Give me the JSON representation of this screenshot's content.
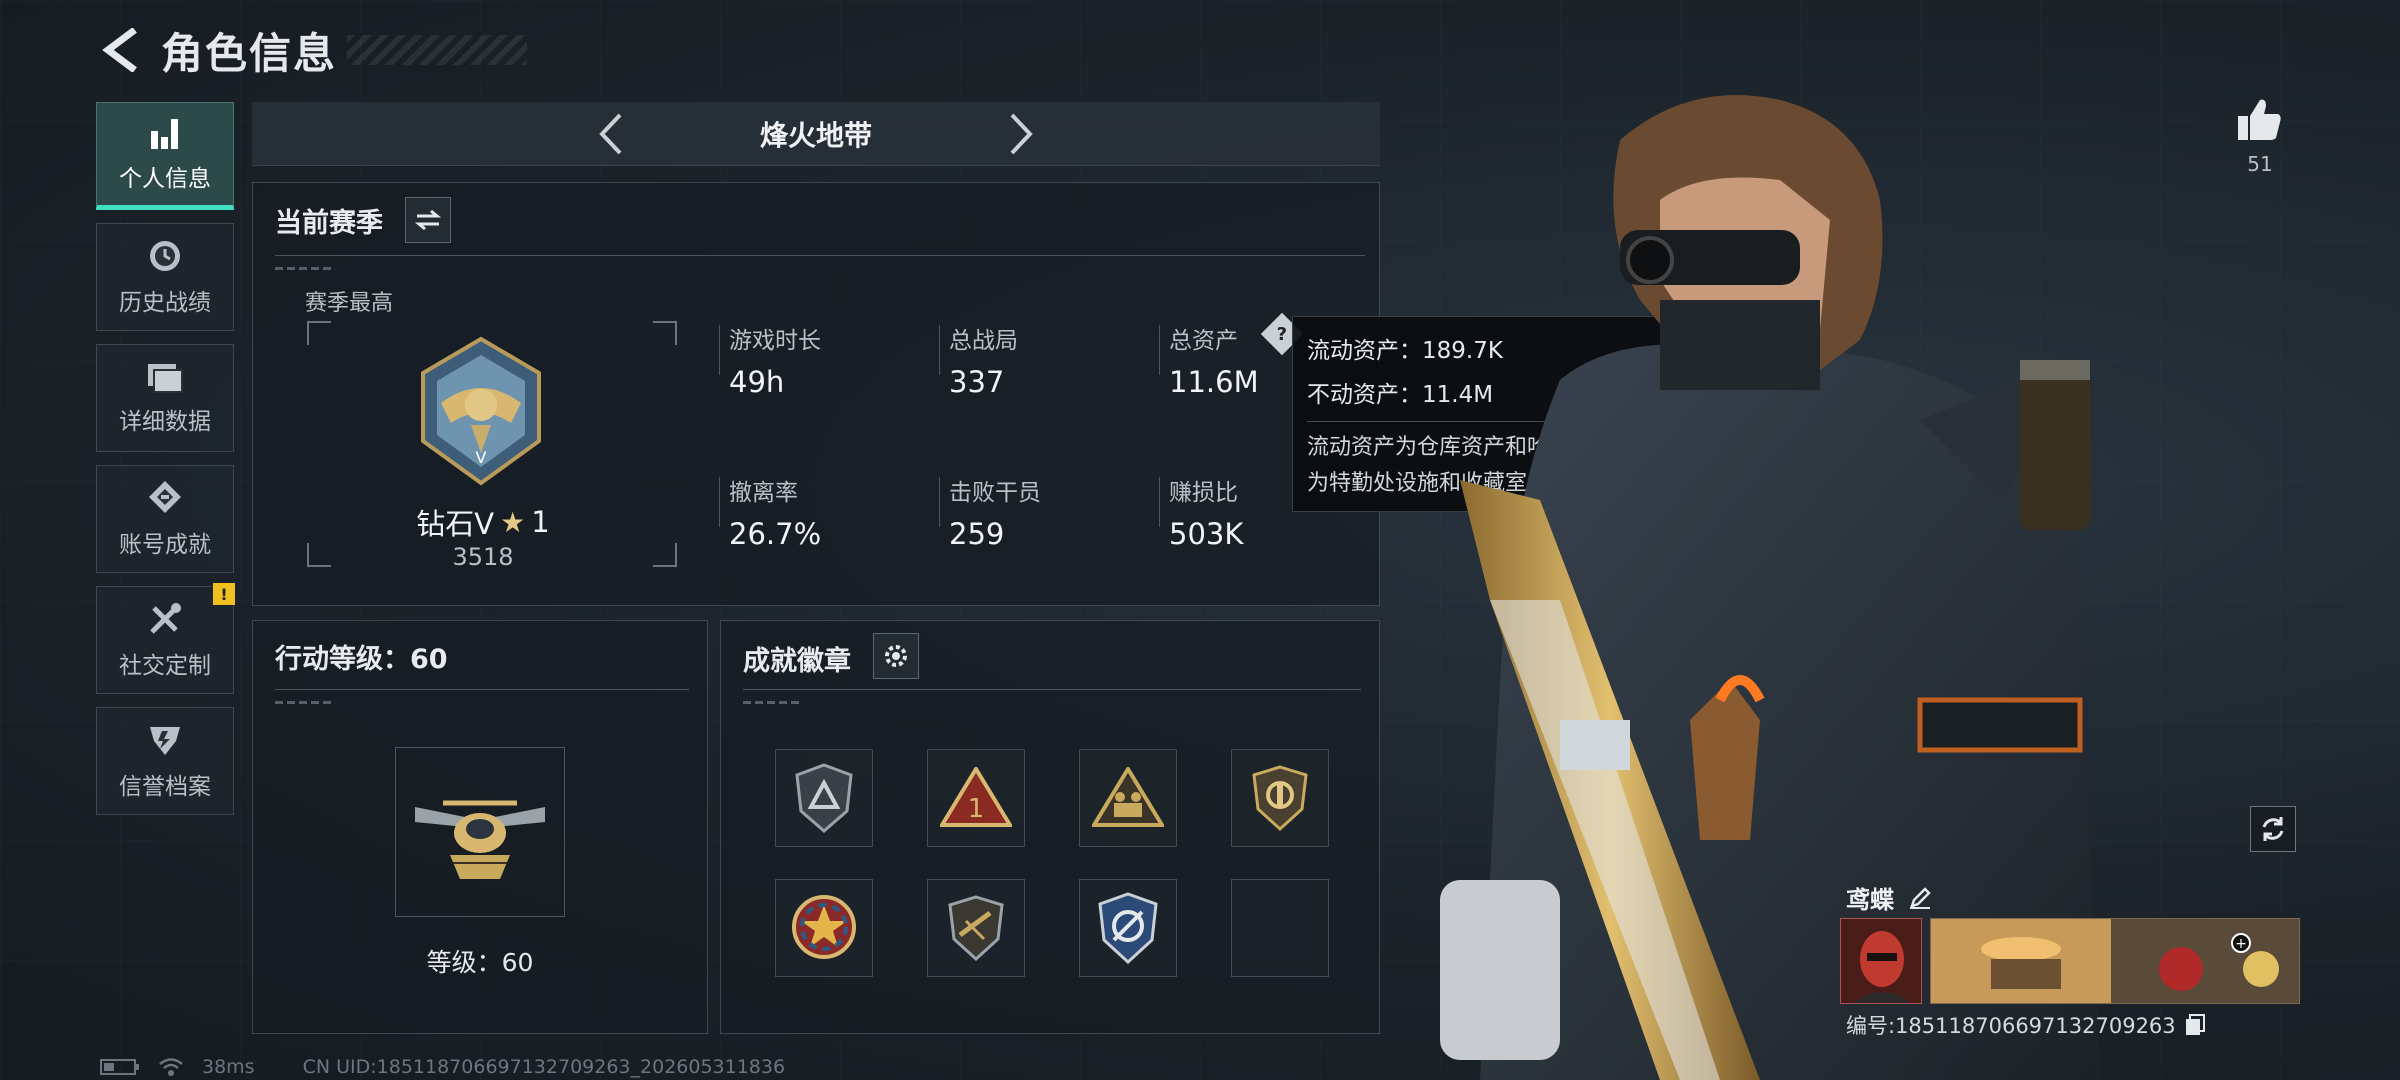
{
  "header": {
    "title": "角色信息",
    "back_icon": "chevron-left-icon"
  },
  "sidebar": {
    "items": [
      {
        "label": "个人信息",
        "icon": "bar-chart-icon",
        "active": true
      },
      {
        "label": "历史战绩",
        "icon": "history-icon"
      },
      {
        "label": "详细数据",
        "icon": "folder-icon"
      },
      {
        "label": "账号成就",
        "icon": "achievement-icon"
      },
      {
        "label": "社交定制",
        "icon": "tools-icon",
        "badge": "!"
      },
      {
        "label": "信誉档案",
        "icon": "credit-icon"
      }
    ]
  },
  "mode": {
    "title": "烽火地带"
  },
  "season": {
    "title": "当前赛季",
    "best_label": "赛季最高",
    "rank_name": "钻石V",
    "rank_stars": "1",
    "rank_points": "3518",
    "stats": {
      "play_time": {
        "label": "游戏时长",
        "value": "49h"
      },
      "total_games": {
        "label": "总战局",
        "value": "337"
      },
      "total_assets": {
        "label": "总资产",
        "value": "11.6M"
      },
      "extract_rate": {
        "label": "撤离率",
        "value": "26.7%"
      },
      "kills": {
        "label": "击败干员",
        "value": "259"
      },
      "profit_ratio": {
        "label": "赚损比",
        "value": "503K"
      }
    }
  },
  "tooltip": {
    "liquid": "流动资产：189.7K",
    "fixed": "不动资产：11.4M",
    "desc_line1": "流动资产为仓库资产和哈夫币，不动资产",
    "desc_line2": "为特勤处设施和收藏室设施"
  },
  "action_level": {
    "title": "行动等级：60",
    "level_label": "等级：60"
  },
  "achievements": {
    "title": "成就徽章"
  },
  "likes": {
    "count": "51"
  },
  "player": {
    "name": "鸢蝶",
    "id": "编号:1851187066971327092​63"
  },
  "status": {
    "ping": "38ms",
    "uid": "CN UID:1851187066971327092​63_202605311836"
  },
  "colors": {
    "accent": "#3fe0c0",
    "badge_yellow": "#f0c020",
    "panel_border": "#3d4852"
  }
}
